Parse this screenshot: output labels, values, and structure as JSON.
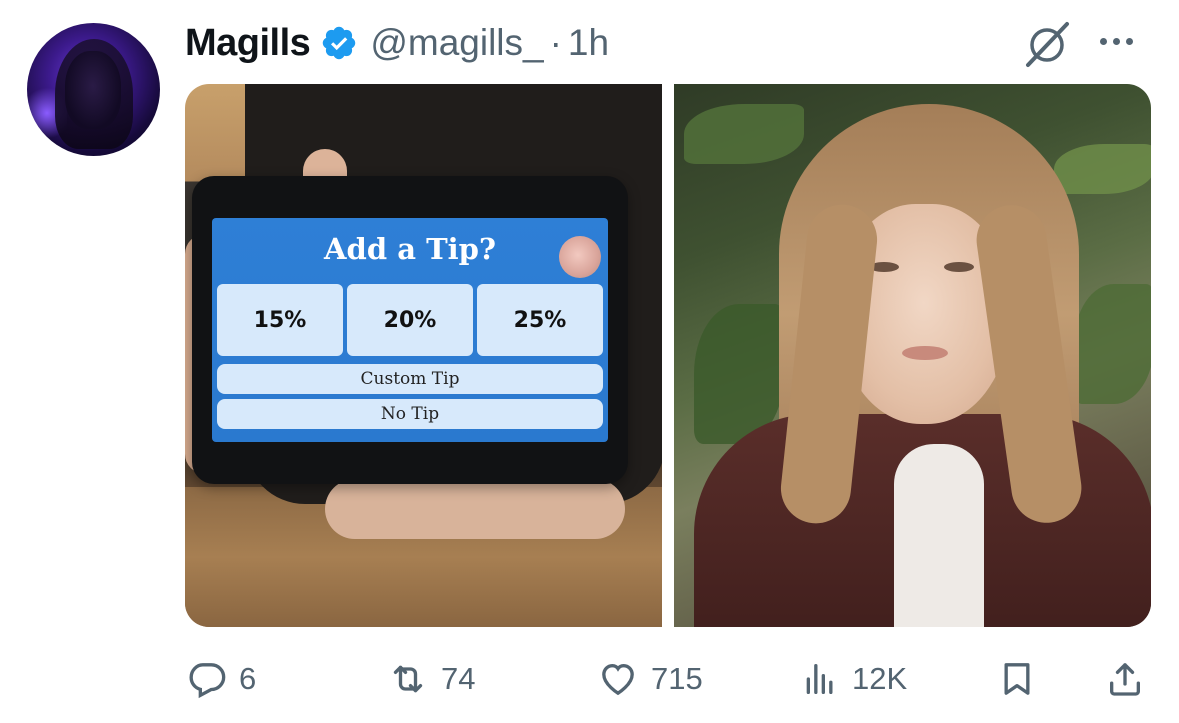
{
  "tweet": {
    "display_name": "Magills",
    "handle": "@magills_",
    "separator": "·",
    "time": "1h"
  },
  "media": {
    "left": {
      "screen_title": "Add a Tip?",
      "tip_options": [
        "15%",
        "20%",
        "25%"
      ],
      "custom_tip": "Custom Tip",
      "no_tip": "No Tip"
    }
  },
  "actions": {
    "replies": "6",
    "retweets": "74",
    "likes": "715",
    "views": "12K"
  },
  "colors": {
    "verified": "#1d9bf0",
    "muted": "#536471",
    "text": "#0f1419",
    "tablet_screen": "#2e7fd6"
  },
  "icons": [
    "verified-badge-icon",
    "grok-icon",
    "more-icon",
    "reply-icon",
    "retweet-icon",
    "like-icon",
    "views-icon",
    "bookmark-icon",
    "share-icon"
  ]
}
